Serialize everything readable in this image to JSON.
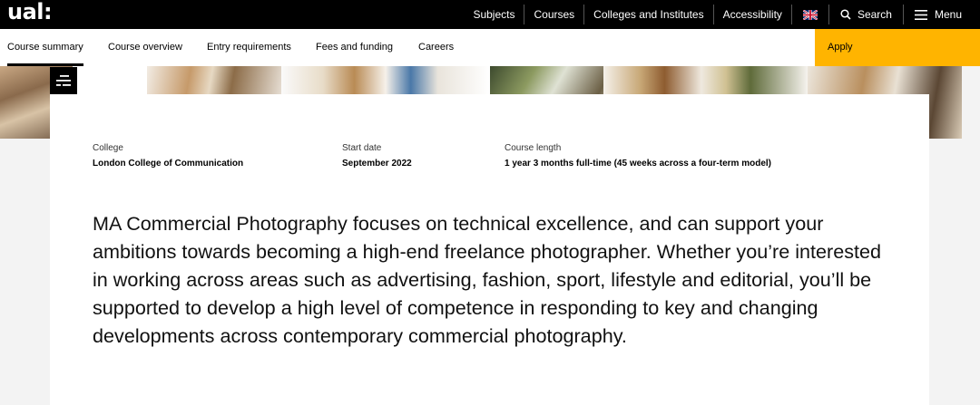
{
  "topbar": {
    "logo": "ual:",
    "links": [
      "Subjects",
      "Courses",
      "Colleges and Institutes",
      "Accessibility"
    ],
    "language_icon": "uk-flag-icon",
    "search_label": "Search",
    "menu_label": "Menu"
  },
  "tabs": {
    "items": [
      "Course summary",
      "Course overview",
      "Entry requirements",
      "Fees and funding",
      "Careers"
    ],
    "active": "Course summary",
    "apply_label": "Apply"
  },
  "course": {
    "college_label": "College",
    "college_value": "London College of Communication",
    "start_label": "Start date",
    "start_value": "September 2022",
    "length_label": "Course length",
    "length_value": "1 year 3 months full-time (45 weeks across a four-term model)"
  },
  "intro": "MA Commercial Photography focuses on technical excellence, and can support your ambitions towards becoming a high-end freelance photographer. Whether you’re interested in working across areas such as advertising, fashion, sport, lifestyle and editorial, you’ll be supported to develop a high level of competence in responding to key and changing developments across contemporary commercial photography.",
  "colors": {
    "accent": "#ffb400",
    "topbar": "#000000",
    "page_bg": "#f3f3f3"
  }
}
